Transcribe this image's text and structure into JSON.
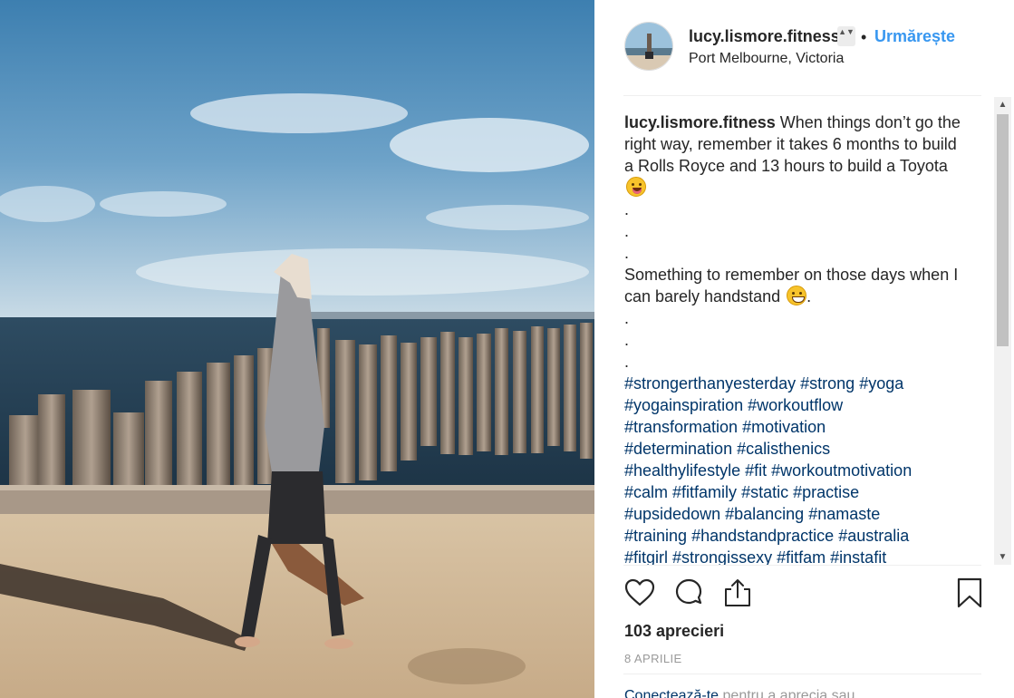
{
  "post": {
    "username": "lucy.lismore.fitness",
    "separator": "•",
    "follow_label": "Urmărește",
    "location": "Port Melbourne, Victoria",
    "user_switch_glyph": "▲▼"
  },
  "caption": {
    "username": "lucy.lismore.fitness",
    "text_1": "When things don’t go the right way, remember it takes 6 months to build a Rolls Royce and 13 hours to build a Toyota",
    "emoji_1": "face-with-tongue-emoji",
    "dot": ".",
    "text_2": "Something to remember on those days when I can barely handstand",
    "emoji_2": "grinning-sweat-emoji",
    "text_2_end": ".",
    "hashtags": [
      "#strongerthanyesterday",
      "#strong",
      "#yoga",
      "#yogainspiration",
      "#workoutflow",
      "#transformation",
      "#motivation",
      "#determination",
      "#calisthenics",
      "#healthylifestyle",
      "#fit",
      "#workoutmotivation",
      "#calm",
      "#fitfamily",
      "#static",
      "#practise",
      "#upsidedown",
      "#balancing",
      "#namaste",
      "#training",
      "#handstandpractice",
      "#australia",
      "#fitgirl",
      "#strongissexy",
      "#fitfam",
      "#instafit"
    ]
  },
  "actions": {
    "like_icon": "heart-icon",
    "comment_icon": "comment-icon",
    "share_icon": "share-icon",
    "save_icon": "bookmark-icon"
  },
  "likes_text": "103 aprecieri",
  "date_text": "8 APRILIE",
  "login_hint": {
    "link_text": "Conectează-te",
    "rest_text": "pentru a aprecia sau"
  },
  "scrollbar": {
    "up_glyph": "▲",
    "down_glyph": "▼"
  },
  "colors": {
    "link": "#3897f0",
    "hashtag": "#003569",
    "text": "#262626",
    "muted": "#999999"
  }
}
